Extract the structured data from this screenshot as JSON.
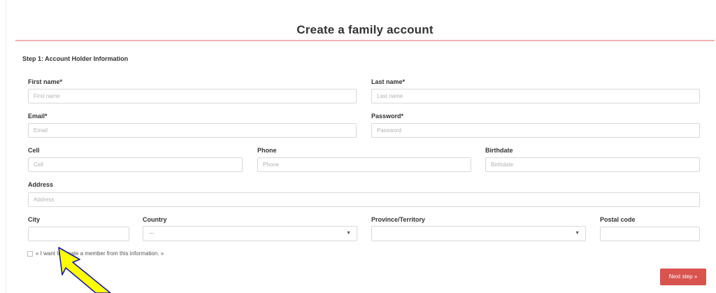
{
  "page": {
    "title": "Create a family account"
  },
  "step": {
    "title": "Step 1: Account Holder Information"
  },
  "fields": {
    "first_name": {
      "label": "First name*",
      "placeholder": "First name"
    },
    "last_name": {
      "label": "Last name*",
      "placeholder": "Last name"
    },
    "email": {
      "label": "Email*",
      "placeholder": "Email"
    },
    "password": {
      "label": "Password*",
      "placeholder": "Password"
    },
    "cell": {
      "label": "Cell",
      "placeholder": "Cell"
    },
    "phone": {
      "label": "Phone",
      "placeholder": "Phone"
    },
    "birthdate": {
      "label": "Birthdate",
      "placeholder": "Birthdate"
    },
    "address": {
      "label": "Address",
      "placeholder": "Address"
    },
    "city": {
      "label": "City",
      "value": ""
    },
    "country": {
      "label": "Country",
      "selected": "---"
    },
    "province": {
      "label": "Province/Territory",
      "selected": ""
    },
    "postal_code": {
      "label": "Postal code",
      "value": ""
    }
  },
  "checkbox": {
    "label": "« I want to create a member from this information. »",
    "checked": false
  },
  "buttons": {
    "next_step": "Next step »"
  },
  "icons": {
    "caret": "dropdown-caret-icon",
    "annotation": "arrow-pointer-icon"
  },
  "colors": {
    "accent": "#d9534f",
    "title_rule": "#f1b3b3",
    "arrow_fill": "#ffff00",
    "arrow_stroke": "#1a1aa6"
  }
}
